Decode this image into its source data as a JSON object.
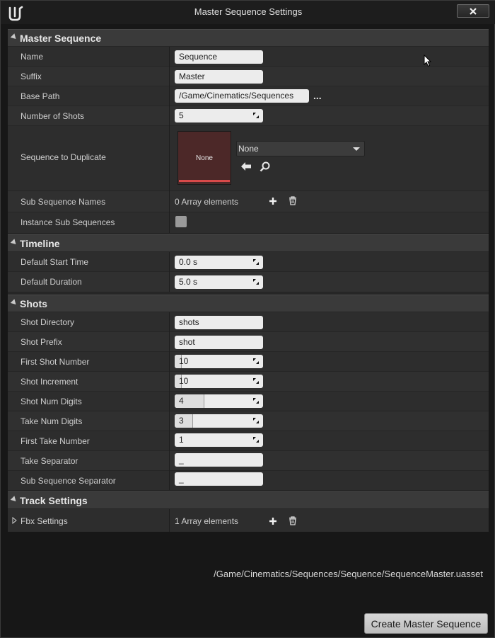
{
  "window": {
    "title": "Master Sequence Settings"
  },
  "sections": {
    "master": {
      "title": "Master Sequence",
      "rows": {
        "name": {
          "label": "Name",
          "value": "Sequence"
        },
        "suffix": {
          "label": "Suffix",
          "value": "Master"
        },
        "base_path": {
          "label": "Base Path",
          "value": "/Game/Cinematics/Sequences",
          "browse": "..."
        },
        "number_of_shots": {
          "label": "Number of Shots",
          "value": "5"
        },
        "sequence_to_duplicate": {
          "label": "Sequence to Duplicate",
          "thumbnail_label": "None",
          "combo_value": "None"
        },
        "sub_sequence_names": {
          "label": "Sub Sequence Names",
          "value": "0 Array elements"
        },
        "instance_sub_sequences": {
          "label": "Instance Sub Sequences",
          "checked": false
        }
      }
    },
    "timeline": {
      "title": "Timeline",
      "rows": {
        "default_start_time": {
          "label": "Default Start Time",
          "value": "0.0 s"
        },
        "default_duration": {
          "label": "Default Duration",
          "value": "5.0 s"
        }
      }
    },
    "shots": {
      "title": "Shots",
      "rows": {
        "shot_directory": {
          "label": "Shot Directory",
          "value": "shots"
        },
        "shot_prefix": {
          "label": "Shot Prefix",
          "value": "shot"
        },
        "first_shot_number": {
          "label": "First Shot Number",
          "value": "10"
        },
        "shot_increment": {
          "label": "Shot Increment",
          "value": "10"
        },
        "shot_num_digits": {
          "label": "Shot Num Digits",
          "value": "4"
        },
        "take_num_digits": {
          "label": "Take Num Digits",
          "value": "3"
        },
        "first_take_number": {
          "label": "First Take Number",
          "value": "1"
        },
        "take_separator": {
          "label": "Take Separator",
          "value": "_"
        },
        "sub_sequence_separator": {
          "label": "Sub Sequence Separator",
          "value": "_"
        }
      }
    },
    "track_settings": {
      "title": "Track Settings",
      "rows": {
        "fbx_settings": {
          "label": "Fbx Settings",
          "value": "1 Array elements"
        }
      }
    }
  },
  "footer": {
    "asset_path": "/Game/Cinematics/Sequences/Sequence/SequenceMaster.uasset",
    "create_label": "Create Master Sequence"
  },
  "colors": {
    "accent_red": "#d84a4a",
    "thumbnail_bg": "#4c2828"
  }
}
